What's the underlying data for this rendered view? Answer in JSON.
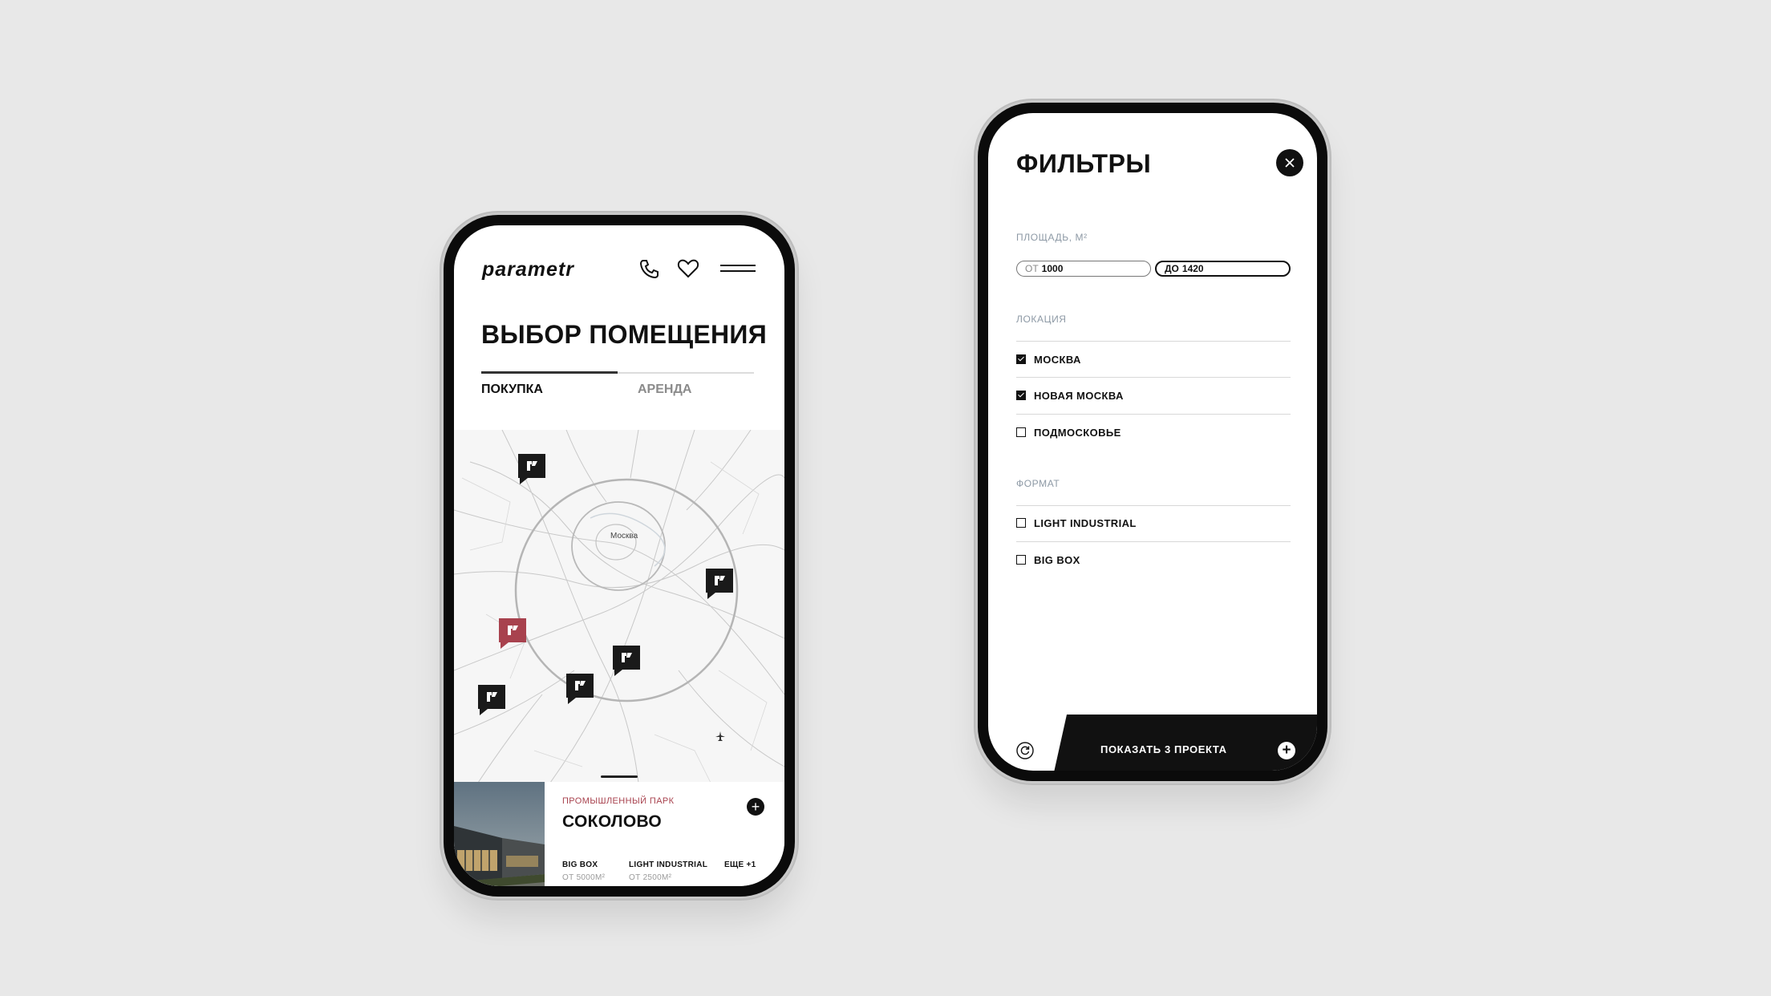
{
  "colors": {
    "background": "#e8e8e8",
    "accent": "#a8424e",
    "dark": "#111111",
    "muted": "#8d99a5"
  },
  "screen1": {
    "logo": "parametr",
    "header_icons": [
      "phone-icon",
      "heart-icon",
      "menu-icon"
    ],
    "title": "ВЫБОР ПОМЕЩЕНИЯ",
    "tabs": [
      {
        "label": "ПОКУПКА",
        "active": true
      },
      {
        "label": "АРЕНДА",
        "active": false
      }
    ],
    "map": {
      "city_label": "Москва"
    },
    "card": {
      "category": "ПРОМЫШЛЕННЫЙ ПАРК",
      "title": "СОКОЛОВО",
      "formats": [
        {
          "name": "BIG BOX",
          "sub": "ОТ 5000М²"
        },
        {
          "name": "LIGHT INDUSTRIAL",
          "sub": "ОТ 2500М²"
        },
        {
          "name": "ЕЩЕ +1",
          "sub": ""
        }
      ]
    }
  },
  "screen2": {
    "title": "ФИЛЬТРЫ",
    "area": {
      "label": "ПЛОЩАДЬ, М²",
      "from_prefix": "ОТ",
      "from_value": "1000",
      "to_prefix": "ДО",
      "to_value": "1420"
    },
    "location": {
      "label": "ЛОКАЦИЯ",
      "options": [
        {
          "label": "МОСКВА",
          "checked": true
        },
        {
          "label": "НОВАЯ МОСКВА",
          "checked": true
        },
        {
          "label": "ПОДМОСКОВЬЕ",
          "checked": false
        }
      ]
    },
    "format": {
      "label": "ФОРМАТ",
      "options": [
        {
          "label": "LIGHT INDUSTRIAL",
          "checked": false
        },
        {
          "label": "BIG BOX",
          "checked": false
        }
      ]
    },
    "show_button": "ПОКАЗАТЬ 3 ПРОЕКТА"
  }
}
